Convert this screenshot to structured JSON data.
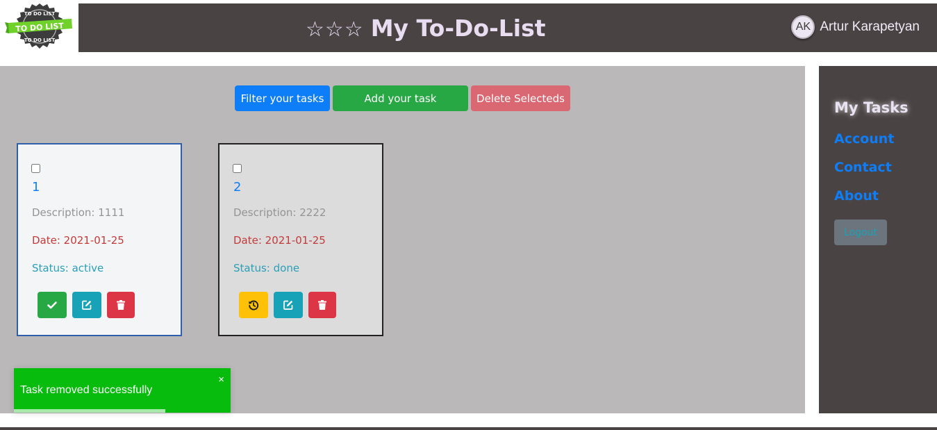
{
  "header": {
    "logo_text_top": "TO DO LIST",
    "logo_text_banner": "TO DO LIST",
    "logo_text_bottom": "TO DO LIST",
    "stars": "☆☆☆",
    "title": "My To-Do-List",
    "user": {
      "initials": "AK",
      "name": "Artur Karapetyan"
    }
  },
  "toolbar": {
    "filter_label": "Filter your tasks",
    "add_label": "Add your task",
    "delete_label": "Delete Selecteds"
  },
  "tasks": [
    {
      "title": "1",
      "description": "Description: 1111",
      "date": "Date: 2021-01-25",
      "status": "Status: active",
      "actions": [
        "check-icon",
        "edit-icon",
        "trash-icon"
      ]
    },
    {
      "title": "2",
      "description": "Description: 2222",
      "date": "Date: 2021-01-25",
      "status": "Status: done",
      "actions": [
        "history-icon",
        "edit-icon",
        "trash-icon"
      ]
    }
  ],
  "toast": {
    "message": "Task removed successfully",
    "close": "×",
    "progress": 0.7
  },
  "sidebar": {
    "items": [
      {
        "label": "My Tasks",
        "active": true
      },
      {
        "label": "Account",
        "active": false
      },
      {
        "label": "Contact",
        "active": false
      },
      {
        "label": "About",
        "active": false
      }
    ],
    "logout_label": "Logout"
  },
  "colors": {
    "header_bg": "#4a4344",
    "main_bg": "#bab8b9",
    "primary": "#0d7df8",
    "success": "#28a745",
    "danger_light": "#d96872",
    "toast": "#07bc0c"
  }
}
